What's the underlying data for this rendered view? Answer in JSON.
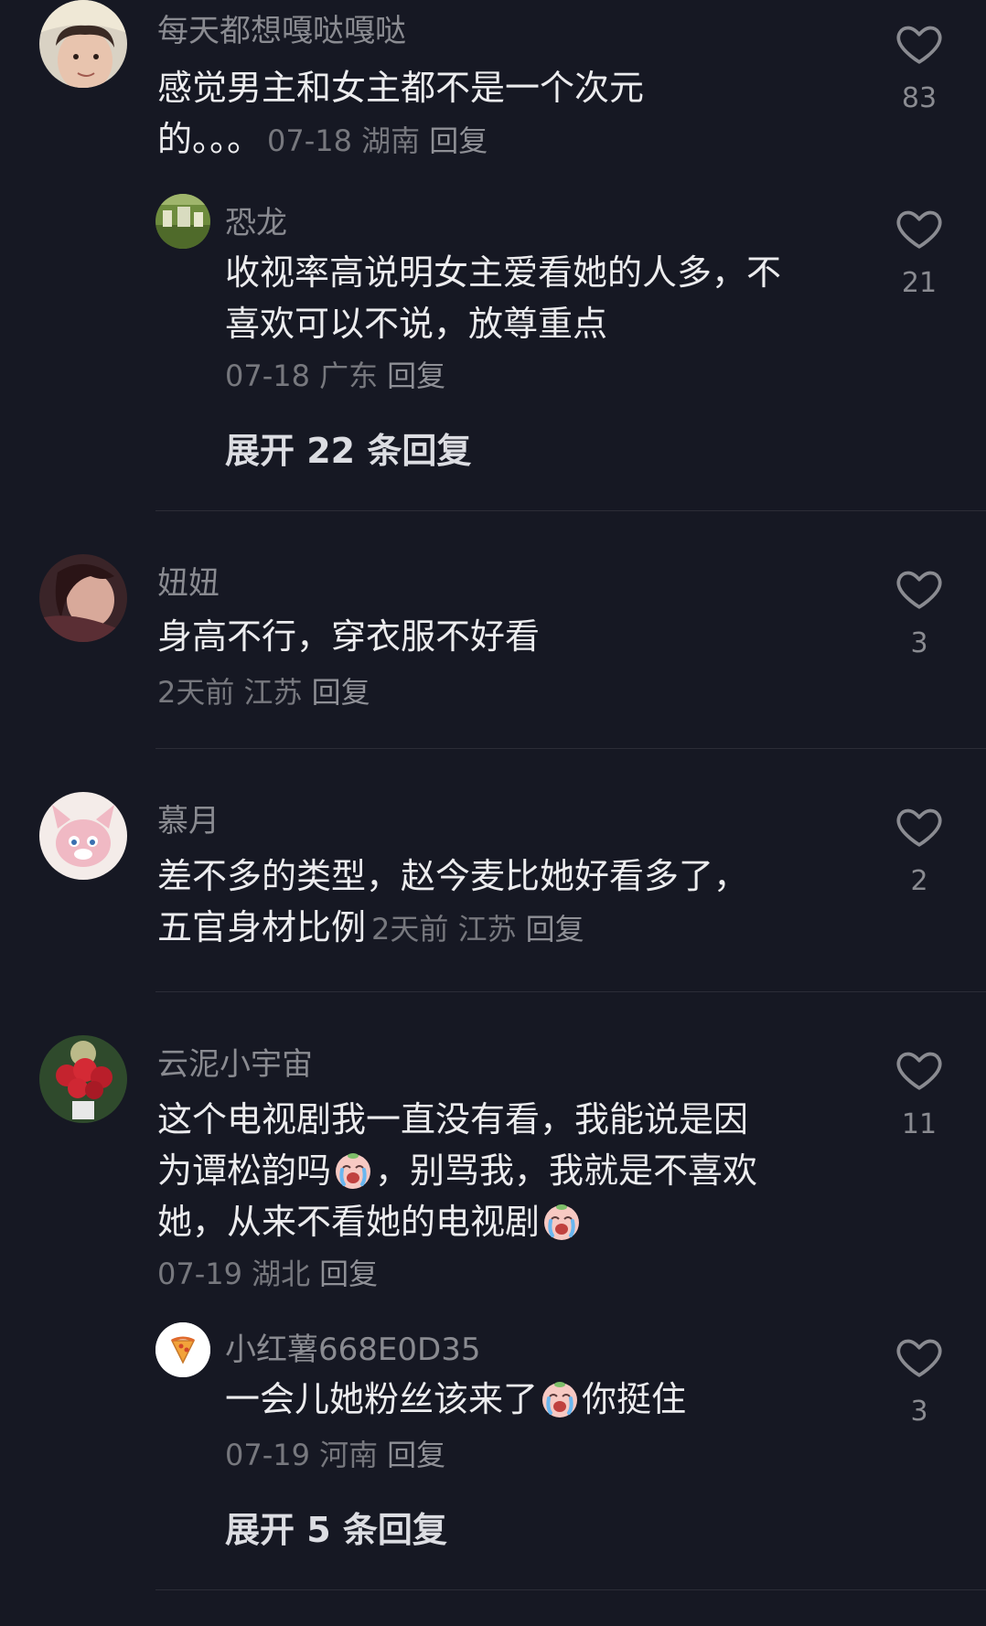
{
  "comments": [
    {
      "username": "每天都想嘎哒嘎哒",
      "text_line1": "感觉男主和女主都不是一个次元",
      "text_line2": "的。。。",
      "date": "07-18",
      "location": "湖南",
      "reply_label": "回复",
      "likes": "83"
    },
    {
      "username": "恐龙",
      "text_line1": "收视率高说明女主爱看她的人多，不",
      "text_line2": "喜欢可以不说，放尊重点",
      "date": "07-18",
      "location": "广东",
      "reply_label": "回复",
      "likes": "21",
      "expand_label": "展开 22 条回复"
    },
    {
      "username": "妞妞",
      "text_line1": "身高不行，穿衣服不好看",
      "date": "2天前",
      "location": "江苏",
      "reply_label": "回复",
      "likes": "3"
    },
    {
      "username": "慕月",
      "text_line1": "差不多的类型，赵今麦比她好看多了，",
      "text_line2": "五官身材比例",
      "date": "2天前",
      "location": "江苏",
      "reply_label": "回复",
      "likes": "2"
    },
    {
      "username": "云泥小宇宙",
      "text_line1": "这个电视剧我一直没有看，我能说是因",
      "text_line2a": "为谭松韵吗",
      "text_line2b": "，别骂我，我就是不喜欢",
      "text_line3": "她，从来不看她的电视剧",
      "date": "07-19",
      "location": "湖北",
      "reply_label": "回复",
      "likes": "11"
    },
    {
      "username": "小红薯668E0D35",
      "text_line1a": "一会儿她粉丝该来了",
      "text_line1b": "你挺住",
      "date": "07-19",
      "location": "河南",
      "reply_label": "回复",
      "likes": "3",
      "expand_label": "展开 5 条回复"
    }
  ],
  "icons": {
    "like": "heart-outline-icon",
    "emoji": "crying-face-emoji-icon"
  },
  "colors": {
    "background": "#161823",
    "username": "#8a8b91",
    "text": "#ececee",
    "meta": "#77787e"
  }
}
